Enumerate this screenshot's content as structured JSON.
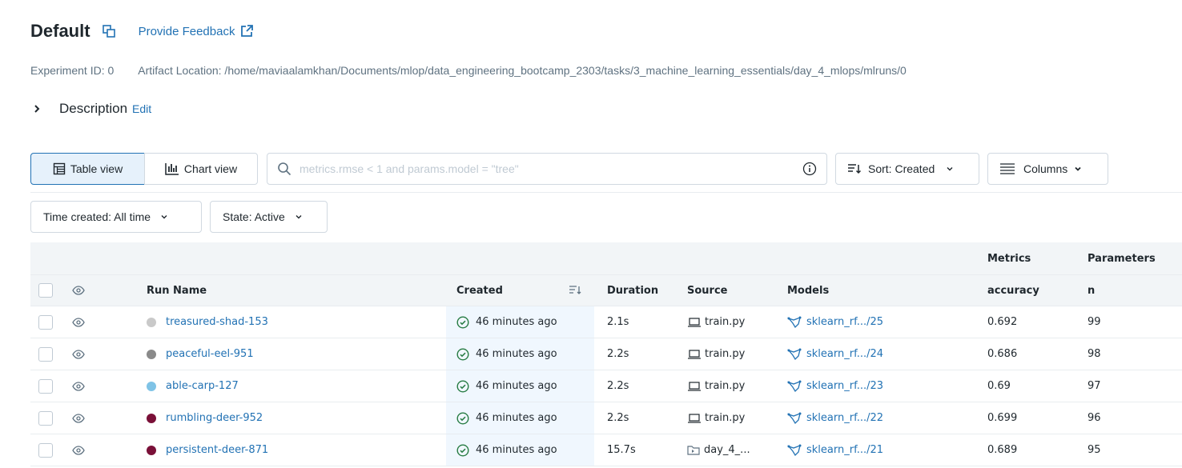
{
  "header": {
    "title": "Default",
    "feedback_label": "Provide Feedback"
  },
  "meta": {
    "experiment_id": "Experiment ID: 0",
    "artifact_location": "Artifact Location: /home/maviaalamkhan/Documents/mlop/data_engineering_bootcamp_2303/tasks/3_machine_learning_essentials/day_4_mlops/mlruns/0"
  },
  "description": {
    "label": "Description",
    "edit_label": "Edit"
  },
  "toolbar": {
    "table_view": "Table view",
    "chart_view": "Chart view",
    "search_placeholder": "metrics.rmse < 1 and params.model = \"tree\"",
    "sort_label": "Sort: Created",
    "columns_label": "Columns"
  },
  "filters": {
    "time_created": "Time created: All time",
    "state": "State: Active"
  },
  "table": {
    "groups": {
      "metrics": "Metrics",
      "parameters": "Parameters"
    },
    "columns": {
      "run_name": "Run Name",
      "created": "Created",
      "duration": "Duration",
      "source": "Source",
      "models": "Models",
      "accuracy": "accuracy",
      "n": "n"
    },
    "rows": [
      {
        "color": "#c9c9c9",
        "run_name": "treasured-shad-153",
        "created": "46 minutes ago",
        "duration": "2.1s",
        "source": "train.py",
        "source_icon": "laptop-icon",
        "model": "sklearn_rf.../25",
        "accuracy": "0.692",
        "n": "99"
      },
      {
        "color": "#8a8a8a",
        "run_name": "peaceful-eel-951",
        "created": "46 minutes ago",
        "duration": "2.2s",
        "source": "train.py",
        "source_icon": "laptop-icon",
        "model": "sklearn_rf.../24",
        "accuracy": "0.686",
        "n": "98"
      },
      {
        "color": "#7fc3e6",
        "run_name": "able-carp-127",
        "created": "46 minutes ago",
        "duration": "2.2s",
        "source": "train.py",
        "source_icon": "laptop-icon",
        "model": "sklearn_rf.../23",
        "accuracy": "0.69",
        "n": "97"
      },
      {
        "color": "#7a1038",
        "run_name": "rumbling-deer-952",
        "created": "46 minutes ago",
        "duration": "2.2s",
        "source": "train.py",
        "source_icon": "laptop-icon",
        "model": "sklearn_rf.../22",
        "accuracy": "0.699",
        "n": "96"
      },
      {
        "color": "#7a1038",
        "run_name": "persistent-deer-871",
        "created": "46 minutes ago",
        "duration": "15.7s",
        "source": "day_4_...",
        "source_icon": "notebook-icon",
        "model": "sklearn_rf.../21",
        "accuracy": "0.689",
        "n": "95"
      }
    ]
  },
  "colors": {
    "accent": "#2272b4",
    "success": "#277c43",
    "border": "#d1d9e1",
    "header_bg": "#f2f5f7"
  }
}
